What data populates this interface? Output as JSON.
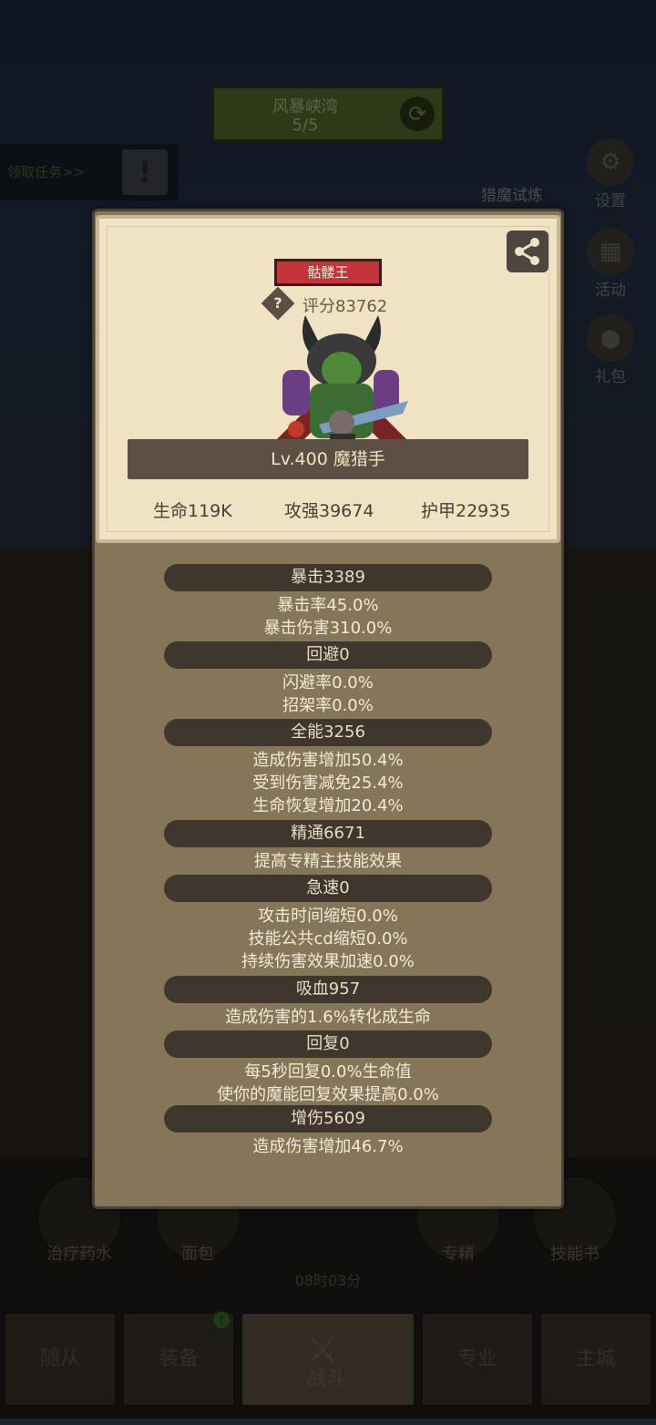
{
  "stage": {
    "title": "风暴峡湾",
    "count": "5/5"
  },
  "quest": {
    "label": "领取任务>>",
    "icon": "!"
  },
  "side": {
    "hunt": "猎魔试炼",
    "settings": "设置",
    "activity": "活动",
    "gift": "礼包"
  },
  "hero": {
    "name": "骷髅王",
    "score": "评分83762",
    "level": "Lv.400 魔猎手",
    "hp": "生命119K",
    "atk": "攻强39674",
    "armor": "护甲22935"
  },
  "stats": [
    {
      "title": "暴击3389",
      "lines": [
        "暴击率45.0%",
        "暴击伤害310.0%"
      ]
    },
    {
      "title": "回避0",
      "lines": [
        "闪避率0.0%",
        "招架率0.0%"
      ]
    },
    {
      "title": "全能3256",
      "lines": [
        "造成伤害增加50.4%",
        "受到伤害减免25.4%",
        "生命恢复增加20.4%"
      ]
    },
    {
      "title": "精通6671",
      "lines": [
        "提高专精主技能效果"
      ]
    },
    {
      "title": "急速0",
      "lines": [
        "攻击时间缩短0.0%",
        "技能公共cd缩短0.0%",
        "持续伤害效果加速0.0%"
      ]
    },
    {
      "title": "吸血957",
      "lines": [
        "造成伤害的1.6%转化成生命"
      ]
    },
    {
      "title": "回复0",
      "lines": [
        "每5秒回复0.0%生命值",
        "使你的魔能回复效果提高0.0%"
      ]
    },
    {
      "title": "增伤5609",
      "lines": [
        "造成伤害增加46.7%"
      ]
    }
  ],
  "bottom": {
    "potion": "治疗药水",
    "bread": "面包",
    "timer": "08时03分",
    "spec": "专精",
    "skillbook": "技能书"
  },
  "tabs": {
    "follower": "随从",
    "equip": "装备",
    "battle": "战斗",
    "profession": "专业",
    "city": "主城"
  }
}
